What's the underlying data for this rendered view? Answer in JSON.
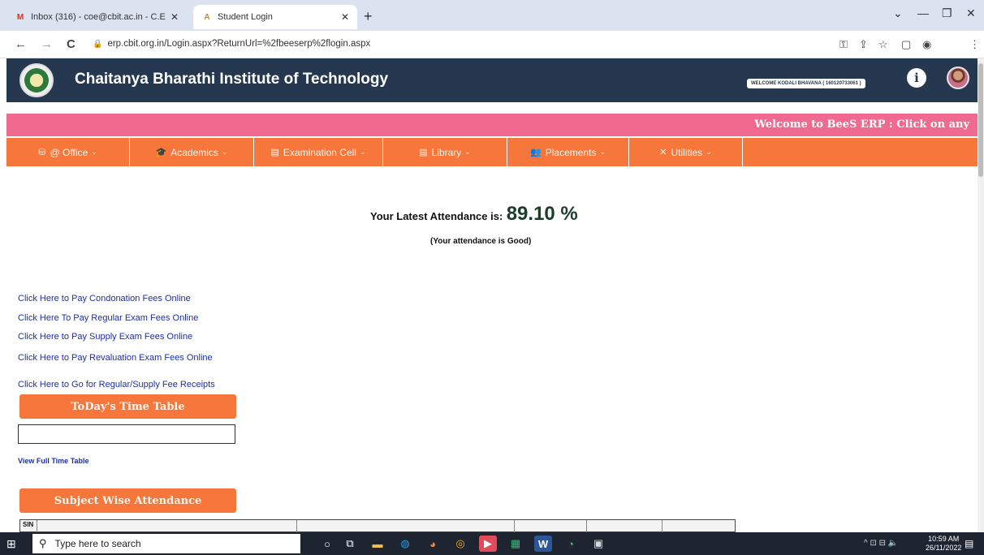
{
  "browser": {
    "tabs": [
      {
        "title": "Inbox (316) - coe@cbit.ac.in - C.E",
        "favicon": "M",
        "close": "✕"
      },
      {
        "title": "Student Login",
        "favicon": "A",
        "close": "✕"
      }
    ],
    "new_tab": "+",
    "window_controls": [
      "⌄",
      "—",
      "❐",
      "✕"
    ],
    "url": "erp.cbit.org.in/Login.aspx?ReturnUrl=%2fbeeserp%2flogin.aspx",
    "nav": {
      "back": "←",
      "forward": "→",
      "reload": "C"
    },
    "toolbar_icons": [
      "⚿",
      "⇪",
      "☆",
      "▢",
      "◉",
      "⋮"
    ]
  },
  "header": {
    "title": "Chaitanya Bharathi Institute of Technology",
    "welcome_user": "WELCOME KODALI BHAVANA ( 160120733061 )",
    "info_symbol": "i"
  },
  "marquee": {
    "text": "Welcome to BeeS ERP : Click on any"
  },
  "menu": [
    {
      "label": "@ Office",
      "icon": "⛁"
    },
    {
      "label": "Academics",
      "icon": "🎓"
    },
    {
      "label": "Examination Cell",
      "icon": "▤"
    },
    {
      "label": "Library",
      "icon": "▤"
    },
    {
      "label": "Placements",
      "icon": "👥"
    },
    {
      "label": "Utilities",
      "icon": "✕"
    }
  ],
  "menu_chevron": "⌄",
  "attendance": {
    "label": "Your Latest Attendance is:",
    "value": "89.10 %",
    "note": "(Your attendance is Good)"
  },
  "links": [
    "Click Here to Pay Condonation Fees Online",
    "Click Here To Pay Regular Exam Fees Online",
    "Click Here to Pay Supply Exam Fees Online",
    "Click Here to Pay Revaluation Exam Fees Online",
    "Click Here to Go for Regular/Supply Fee Receipts"
  ],
  "timetable": {
    "button": "ToDay's Time Table",
    "view_full": "View Full Time Table"
  },
  "subject_attendance": {
    "button": "Subject Wise Attendance"
  },
  "table": {
    "first_header": "SIN"
  },
  "taskbar": {
    "start": "⊞",
    "search_placeholder": "Type here to search",
    "search_icon": "⚲",
    "apps": [
      "○",
      "⧉",
      "▬",
      "◍",
      "◕",
      "◎",
      "▶",
      "▦",
      "W",
      "◔",
      "▣"
    ],
    "tray": "^ ⊡ ⊟ 🔈",
    "time": "10:59 AM",
    "date": "26/11/2022",
    "notification": "▤"
  },
  "colors": {
    "header_bg": "#25384f",
    "marquee_bg": "#f06a8f",
    "menu_bg": "#f7763b",
    "link": "#1b2fa8"
  }
}
